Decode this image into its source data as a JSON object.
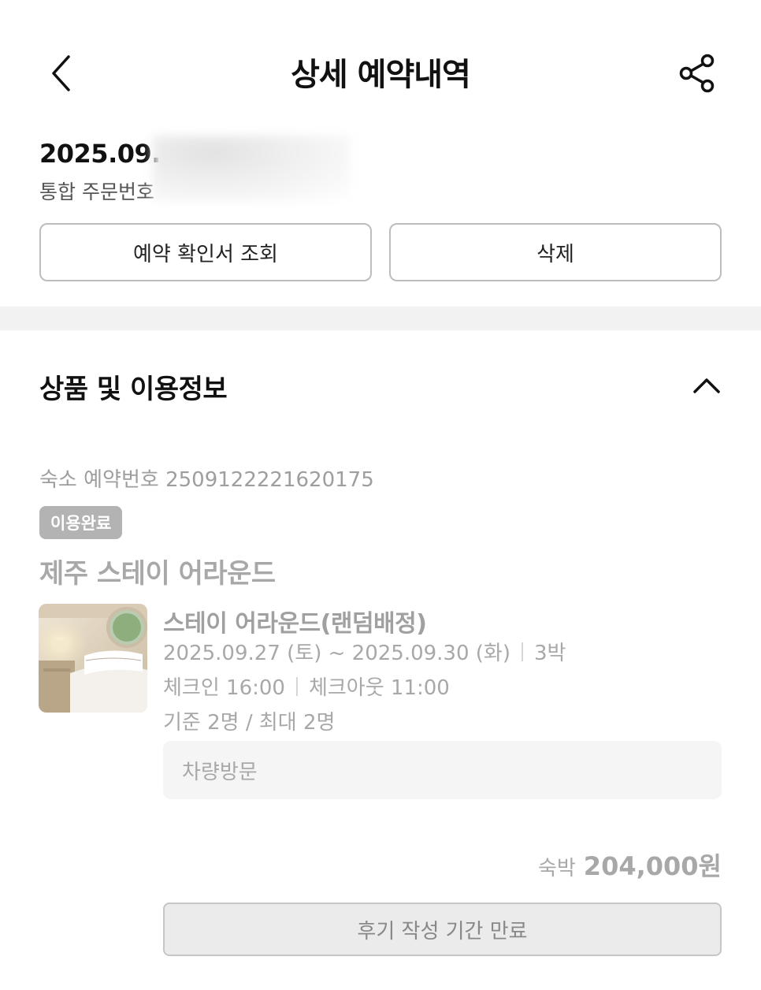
{
  "header": {
    "title": "상세 예약내역"
  },
  "order": {
    "date_visible": "2025.09.",
    "number_label": "통합 주문번호"
  },
  "actions": {
    "confirm_label": "예약 확인서 조회",
    "delete_label": "삭제"
  },
  "section": {
    "title": "상품 및 이용정보"
  },
  "booking": {
    "reservation_label": "숙소 예약번호",
    "reservation_number": "2509122221620175",
    "status": "이용완료",
    "property_name": "제주 스테이 어라운드",
    "room_name": "스테이 어라운드(랜덤배정)",
    "dates": "2025.09.27 (토) ~ 2025.09.30 (화)",
    "nights": "3박",
    "checkin": "체크인 16:00",
    "checkout": "체크아웃 11:00",
    "capacity": "기준 2명 / 최대 2명",
    "visit_method": "차량방문",
    "price_label": "숙박",
    "price": "204,000원",
    "review_label": "후기 작성 기간 만료"
  },
  "colors": {
    "badge_bg": "#b3b3b3",
    "muted_text": "#a8a8a8",
    "divider": "#f2f2f2"
  },
  "icons": {
    "back": "chevron-left-icon",
    "share": "share-icon",
    "collapse": "chevron-up-icon"
  }
}
